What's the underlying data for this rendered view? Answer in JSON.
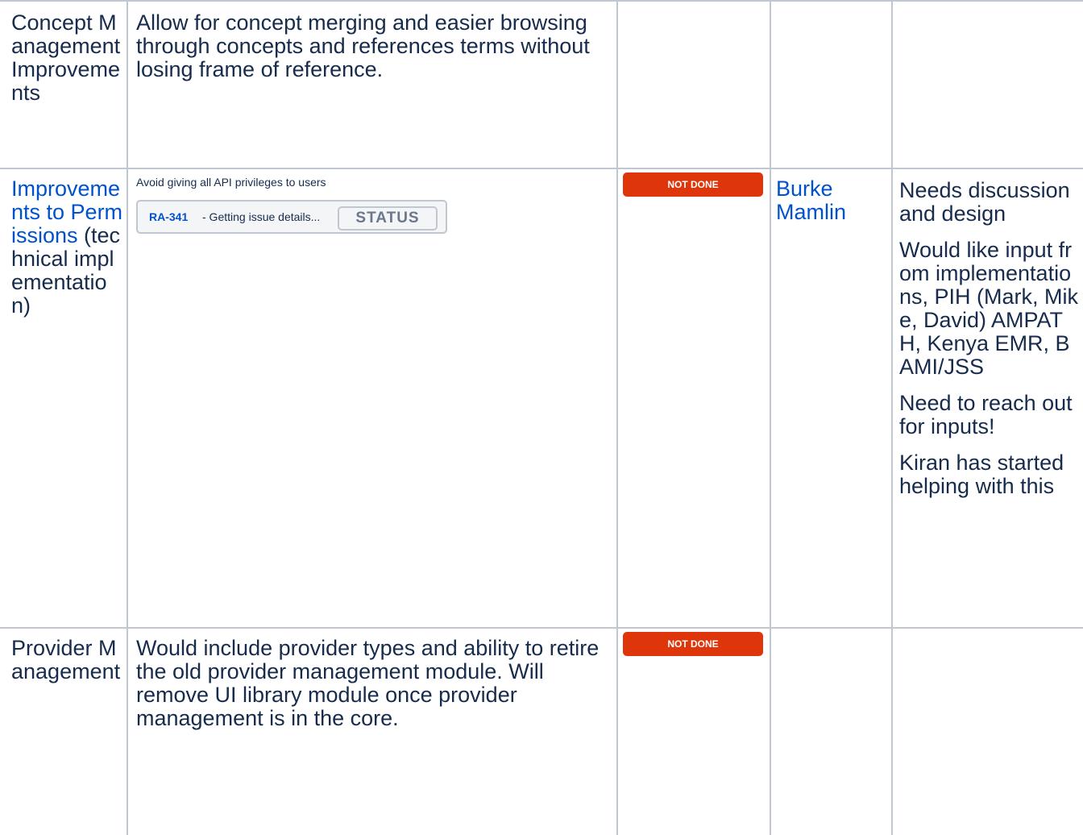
{
  "rows": [
    {
      "feature": "Concept Management Improvements",
      "description": "Allow for concept merging and easier browsing through concepts and references terms without losing frame of reference.",
      "status": "",
      "owner": "",
      "notes": []
    },
    {
      "feature_link": "Improvements to Permissions",
      "feature_suffix": "(technical implementation)",
      "description": "Avoid giving all API privileges to users",
      "jira": {
        "key": "RA-341",
        "text": " - Getting issue details...",
        "status_label": "STATUS"
      },
      "status": "NOT DONE",
      "owner": "Burke Mamlin",
      "notes": [
        "Needs discussion and design",
        "Would like input from implementations, PIH (Mark, Mike, David) AMPATH, Kenya EMR, BAMI/JSS",
        "Need to reach out for inputs!",
        "Kiran has started helping with this"
      ]
    },
    {
      "feature": "Provider Management",
      "description": "Would include provider types and ability to retire the old provider management module. Will remove UI library module once provider management is in the core.",
      "status": "NOT DONE",
      "owner": "",
      "notes": []
    }
  ],
  "colors": {
    "border": "#c1c7d0",
    "link": "#0052cc",
    "text": "#172b4d",
    "status_not_done": "#de350b"
  }
}
